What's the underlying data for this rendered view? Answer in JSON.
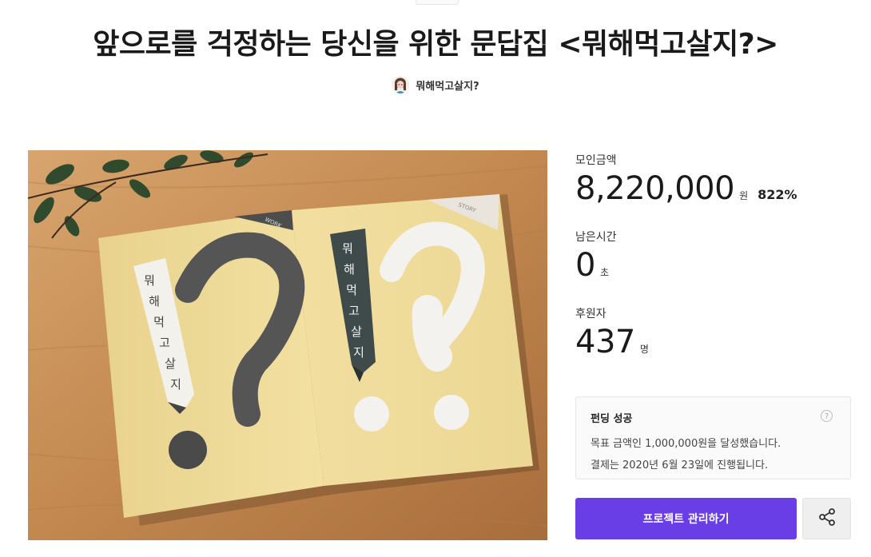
{
  "project": {
    "title": "앞으로를 걱정하는 당신을 위한 문답집 <뭐해먹고살지?>",
    "creator_name": "뭐해먹고살지?"
  },
  "hero_image": {
    "left_spine_text": [
      "뭐",
      "해",
      "먹",
      "고",
      "살",
      "지"
    ],
    "right_spine_text": [
      "뭐",
      "해",
      "먹",
      "고",
      "살",
      "지"
    ],
    "left_corner": "WORK",
    "right_corner": "STORY"
  },
  "stats": {
    "raised_label": "모인금액",
    "raised_value": "8,220,000",
    "raised_unit": "원",
    "raised_percent": "822%",
    "time_label": "남은시간",
    "time_value": "0",
    "time_unit": "초",
    "backers_label": "후원자",
    "backers_value": "437",
    "backers_unit": "명"
  },
  "funding": {
    "status": "펀딩 성공",
    "goal_text": "목표 금액인 1,000,000원을 달성했습니다.",
    "payment_text": "결제는 2020년 6월 23일에 진행됩니다.",
    "help_icon": "?"
  },
  "actions": {
    "manage_label": "프로젝트 관리하기",
    "share_icon": "share-icon"
  },
  "colors": {
    "accent": "#6a3ee6",
    "paper": "#f0dc96",
    "table": "#c48f5c"
  }
}
